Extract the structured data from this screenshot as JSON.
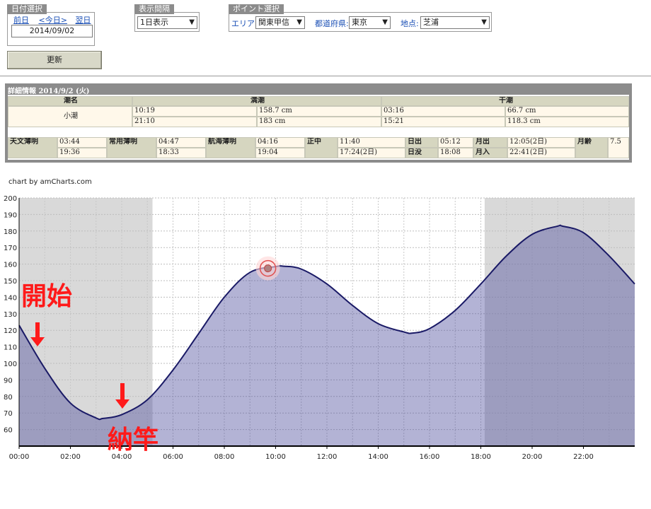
{
  "date_select": {
    "title": "日付選択",
    "prev": "前日",
    "today": "<今日>",
    "next": "翌日",
    "date": "2014/09/02"
  },
  "interval_select": {
    "title": "表示間隔",
    "value": "1日表示"
  },
  "point_select": {
    "title": "ポイント選択",
    "area_label": "エリア:",
    "area_value": "関東甲信",
    "pref_label": "都道府県:",
    "pref_value": "東京",
    "spot_label": "地点:",
    "spot_value": "芝浦"
  },
  "update_button": "更新",
  "detail": {
    "heading": "詳細情報  2014/9/2 (火)",
    "col_tide_name": "潮名",
    "col_high": "満潮",
    "col_low": "干潮",
    "tide_name": "小潮",
    "high": [
      {
        "time": "10:19",
        "level": "158.7 cm"
      },
      {
        "time": "21:10",
        "level": "183 cm"
      }
    ],
    "low": [
      {
        "time": "03:16",
        "level": "66.7 cm"
      },
      {
        "time": "15:21",
        "level": "118.3 cm"
      }
    ],
    "astro_twilight_label": "天文薄明",
    "astro_twilight": [
      "03:44",
      "19:36"
    ],
    "civil_twilight_label": "常用薄明",
    "civil_twilight": [
      "04:47",
      "18:33"
    ],
    "nautical_twilight_label": "航海薄明",
    "nautical_twilight": [
      "04:16",
      "19:04"
    ],
    "noon_label": "正中",
    "noon": [
      "11:40",
      "17:24(2日)"
    ],
    "sunrise_label": "日出",
    "sunrise": "05:12",
    "sunset_label": "日没",
    "sunset": "18:08",
    "moonrise_label": "月出",
    "moonrise": "12:05(2日)",
    "moonset_label": "月入",
    "moonset": "22:41(2日)",
    "moon_age_label": "月齢",
    "moon_age": "7.5"
  },
  "chart_credit": "chart by amCharts.com",
  "annotations": {
    "start": "開始",
    "end": "納竿"
  },
  "colors": {
    "line": "#1a1a66",
    "fill": "#b3b3d9",
    "night": "#d9d9d9",
    "annotation": "#ff1a1a"
  },
  "chart_data": {
    "type": "area",
    "x_unit": "hour",
    "xlim": [
      0,
      24
    ],
    "ylim": [
      50,
      200
    ],
    "y_ticks": [
      60,
      70,
      80,
      90,
      100,
      110,
      120,
      130,
      140,
      150,
      160,
      170,
      180,
      190,
      200
    ],
    "x_ticks": [
      "00:00",
      "02:00",
      "04:00",
      "06:00",
      "08:00",
      "10:00",
      "12:00",
      "14:00",
      "16:00",
      "18:00",
      "20:00",
      "22:00"
    ],
    "grid": true,
    "night_bands": [
      [
        0,
        5.2
      ],
      [
        18.15,
        24
      ]
    ],
    "cursor_hour": 9.7,
    "x": [
      0,
      1,
      2,
      3,
      3.27,
      4,
      5,
      6,
      7,
      8,
      9,
      10,
      10.32,
      11,
      12,
      13,
      14,
      15,
      15.35,
      16,
      17,
      18,
      19,
      20,
      21,
      21.17,
      22,
      23,
      24
    ],
    "y": [
      123,
      97,
      76,
      67,
      66.7,
      69,
      78,
      96,
      118,
      140,
      155,
      158.5,
      158.7,
      157,
      148,
      135,
      124,
      119,
      118.3,
      121,
      132,
      148,
      165,
      178,
      183,
      183,
      179,
      165,
      148
    ]
  }
}
